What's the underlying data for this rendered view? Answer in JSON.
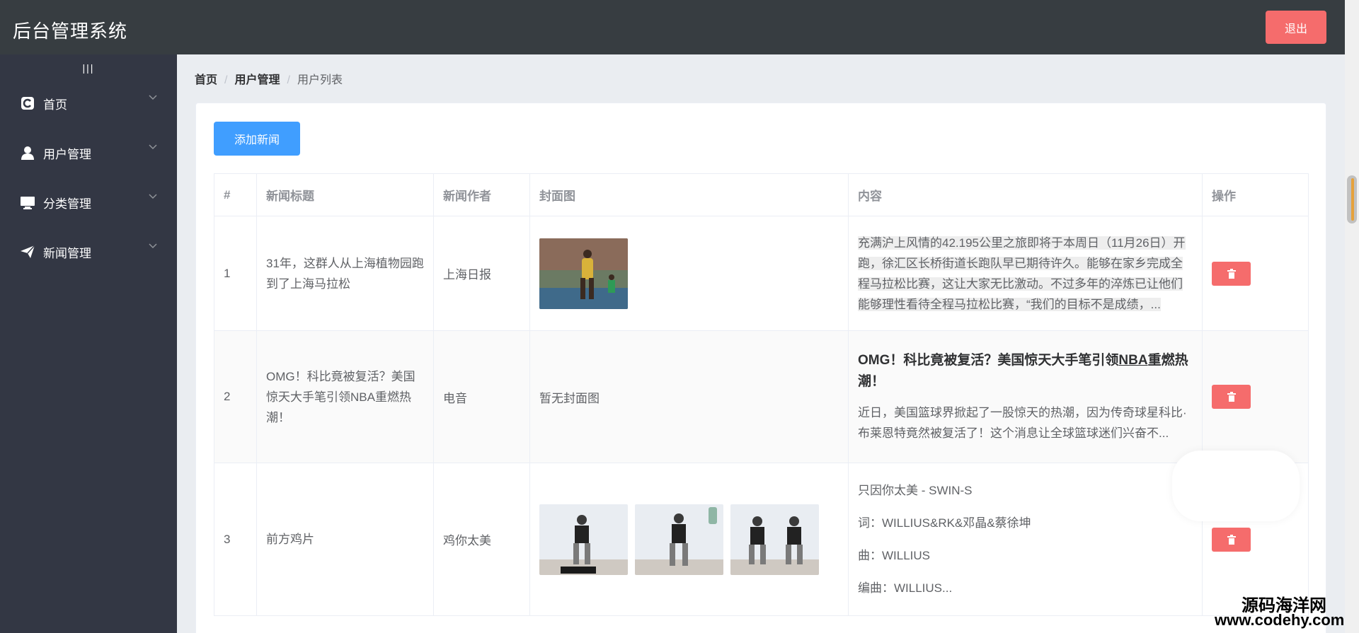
{
  "header": {
    "title": "后台管理系统",
    "logout_label": "退出"
  },
  "sidebar": {
    "toggle": "|||",
    "items": [
      {
        "label": "首页",
        "icon": "home-c-icon"
      },
      {
        "label": "用户管理",
        "icon": "user-icon"
      },
      {
        "label": "分类管理",
        "icon": "monitor-icon"
      },
      {
        "label": "新闻管理",
        "icon": "send-icon"
      }
    ]
  },
  "breadcrumb": {
    "home": "首页",
    "section": "用户管理",
    "page": "用户列表"
  },
  "toolbar": {
    "add_label": "添加新闻"
  },
  "table": {
    "headers": [
      "#",
      "新闻标题",
      "新闻作者",
      "封面图",
      "内容",
      "操作"
    ],
    "rows": [
      {
        "index": "1",
        "title": "31年，这群人从上海植物园跑到了上海马拉松",
        "author": "上海日报",
        "content": "充满沪上风情的42.195公里之旅即将于本周日（11月26日）开跑，徐汇区长桥街道长跑队早已期待许久。能够在家乡完成全程马拉松比赛，这让大家无比激动。不过多年的淬炼已让他们能够理性看待全程马拉松比赛，“我们的目标不是成绩，..."
      },
      {
        "index": "2",
        "title": "OMG！科比竟被复活？美国惊天大手笔引领NBA重燃热潮！",
        "author": "电音",
        "cover_text": "暂无封面图",
        "content_heading_pre": "OMG！科比竟被复活？美国惊天大手笔引领",
        "content_heading_u": "NBA",
        "content_heading_post": "重燃热潮！",
        "content_text": "近日，美国篮球界掀起了一股惊天的热潮，因为传奇球星科比·布莱恩特竟然被复活了！这个消息让全球篮球迷们兴奋不..."
      },
      {
        "index": "3",
        "title": "前方鸡片",
        "author": "鸡你太美",
        "content_lines": [
          "只因你太美 - SWIN-S",
          "词：WILLIUS&RK&邓晶&蔡徐坤",
          "曲：WILLIUS",
          "编曲：WILLIUS..."
        ]
      }
    ]
  },
  "watermark": {
    "line1": "源码海洋网",
    "line2": "www.codehy.com"
  },
  "colors": {
    "header": "#373d41",
    "sidebar": "#333744",
    "primary": "#409eff",
    "danger": "#f56c6c"
  }
}
